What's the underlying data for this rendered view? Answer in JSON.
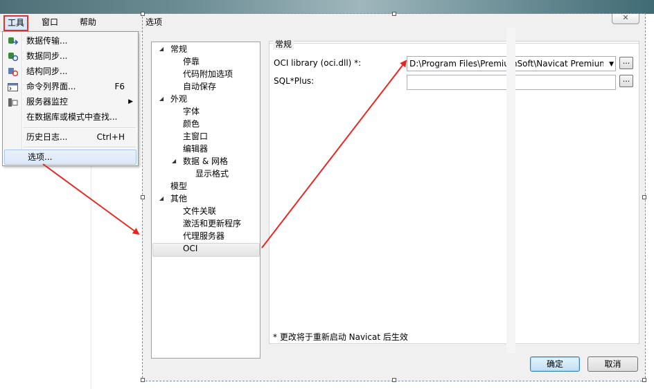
{
  "menubar": {
    "items": [
      {
        "label": "工具",
        "active": true
      },
      {
        "label": "窗口"
      },
      {
        "label": "帮助"
      }
    ]
  },
  "tools_menu": {
    "items": [
      {
        "label": "数据传输...",
        "icon": "data-transfer-icon"
      },
      {
        "label": "数据同步...",
        "icon": "data-sync-icon"
      },
      {
        "label": "结构同步...",
        "icon": "structure-sync-icon"
      },
      {
        "label": "命令列界面...",
        "shortcut": "F6",
        "icon": "console-icon"
      },
      {
        "label": "服务器监控",
        "submenu": true,
        "icon": "server-monitor-icon"
      },
      {
        "label": "在数据库或模式中查找..."
      },
      {
        "label": "历史日志...",
        "shortcut": "Ctrl+H"
      },
      {
        "label": "选项..."
      }
    ]
  },
  "dialog": {
    "title": "选项",
    "close": "✕",
    "tree": [
      {
        "label": "常规",
        "level": 0,
        "expanded": true
      },
      {
        "label": "停靠",
        "level": 1
      },
      {
        "label": "代码附加选项",
        "level": 1
      },
      {
        "label": "自动保存",
        "level": 1
      },
      {
        "label": "外观",
        "level": 0,
        "expanded": true
      },
      {
        "label": "字体",
        "level": 1
      },
      {
        "label": "颜色",
        "level": 1
      },
      {
        "label": "主窗口",
        "level": 1
      },
      {
        "label": "编辑器",
        "level": 1
      },
      {
        "label": "数据 & 网格",
        "level": 1,
        "expanded": true
      },
      {
        "label": "显示格式",
        "level": 2
      },
      {
        "label": "模型",
        "level": 0
      },
      {
        "label": "其他",
        "level": 0,
        "expanded": true
      },
      {
        "label": "文件关联",
        "level": 1
      },
      {
        "label": "激活和更新程序",
        "level": 1
      },
      {
        "label": "代理服务器",
        "level": 1
      },
      {
        "label": "OCI",
        "level": 1,
        "selected": true
      }
    ],
    "group_title": "常规",
    "oci_label": "OCI library (oci.dll) *:",
    "oci_value": "D:\\Program Files\\PremiumSoft\\Navicat Premium\\",
    "sqlplus_label": "SQL*Plus:",
    "sqlplus_value": "",
    "browse": "...",
    "note": "* 更改将于重新启动 Navicat 后生效",
    "ok": "确定",
    "cancel": "取消"
  },
  "colors": {
    "annotation_arrow": "#e8261f",
    "selection_outline": "#e2312f"
  }
}
